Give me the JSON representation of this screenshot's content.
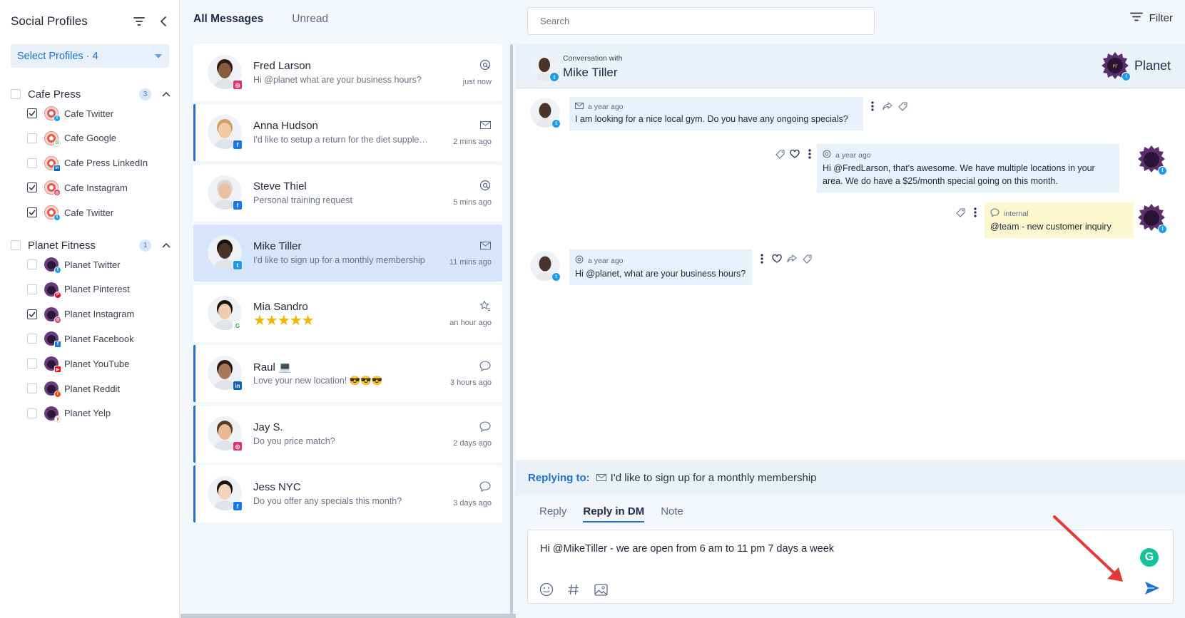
{
  "sidebar": {
    "title": "Social Profiles",
    "select_profiles": "Select Profiles · 4",
    "groups": [
      {
        "name": "Cafe Press",
        "count": "3",
        "profiles": [
          {
            "label": "Cafe Twitter",
            "checked": true,
            "network": "twitter"
          },
          {
            "label": "Cafe Google",
            "checked": false,
            "network": "google"
          },
          {
            "label": "Cafe Press LinkedIn",
            "checked": false,
            "network": "linkedin"
          },
          {
            "label": "Cafe Instagram",
            "checked": true,
            "network": "instagram"
          },
          {
            "label": "Cafe Twitter",
            "checked": true,
            "network": "twitter"
          }
        ]
      },
      {
        "name": "Planet Fitness",
        "count": "1",
        "profiles": [
          {
            "label": "Planet Twitter",
            "checked": false,
            "network": "twitter"
          },
          {
            "label": "Planet Pinterest",
            "checked": false,
            "network": "pinterest"
          },
          {
            "label": "Planet Instagram",
            "checked": true,
            "network": "instagram"
          },
          {
            "label": "Planet Facebook",
            "checked": false,
            "network": "facebook"
          },
          {
            "label": "Planet YouTube",
            "checked": false,
            "network": "youtube"
          },
          {
            "label": "Planet Reddit",
            "checked": false,
            "network": "reddit"
          },
          {
            "label": "Planet Yelp",
            "checked": false,
            "network": "yelp"
          }
        ]
      }
    ]
  },
  "inbox": {
    "tabs": [
      "All Messages",
      "Unread"
    ],
    "messages": [
      {
        "name": "Fred Larson",
        "preview": "Hi @planet what are your business hours?",
        "time": "just now",
        "type_icon": "at-icon",
        "network": "instagram"
      },
      {
        "name": "Anna Hudson",
        "preview": "I'd like to setup a return for the diet supplement I ordered",
        "time": "2 mins ago",
        "type_icon": "mail-icon",
        "network": "facebook"
      },
      {
        "name": "Steve Thiel",
        "preview": "Personal training request",
        "time": "5 mins ago",
        "type_icon": "at-icon",
        "network": "facebook"
      },
      {
        "name": "Mike Tiller",
        "preview": "I'd like to sign up for a monthly membership",
        "time": "11 mins ago",
        "type_icon": "mail-icon",
        "network": "twitter"
      },
      {
        "name": "Mia Sandro",
        "preview": "★★★★★",
        "time": "an hour ago",
        "type_icon": "star-review-icon",
        "network": "google",
        "rating": 5
      },
      {
        "name": "Raul 💻",
        "preview": "Love your new location! 😎😎😎",
        "time": "3 hours ago",
        "type_icon": "comment-icon",
        "network": "linkedin"
      },
      {
        "name": "Jay S.",
        "preview": "Do you price match?",
        "time": "2 days ago",
        "type_icon": "comment-icon",
        "network": "instagram"
      },
      {
        "name": "Jess NYC",
        "preview": "Do you offer any specials this month?",
        "time": "3 days ago",
        "type_icon": "comment-icon",
        "network": "facebook"
      }
    ]
  },
  "conversation": {
    "search_placeholder": "Search",
    "filter_label": "Filter",
    "with_label": "Conversation with",
    "contact": "Mike Tiller",
    "brand": "Planet",
    "messages": [
      {
        "direction": "in",
        "time": "a year ago",
        "text": "I am looking for a nice local gym. Do you have any ongoing specials?"
      },
      {
        "direction": "out",
        "time": "a year ago",
        "text_line1": "Hi @FredLarson, that's awesome. We have multiple locations in your",
        "text_line2": "area. We do have a $25/month special going on this month."
      },
      {
        "direction": "note",
        "time": "internal",
        "text": "@team - new customer inquiry"
      },
      {
        "direction": "in",
        "time": "a year ago",
        "text": "Hi @planet, what are your business hours?"
      }
    ],
    "replying_label": "Replying to:",
    "replying_to": "I'd like to sign up for a monthly membership",
    "reply_tabs": [
      "Reply",
      "Reply in DM",
      "Note"
    ],
    "active_reply_tab": "Reply in DM",
    "draft": "Hi @MikeTiller - we are open from 6 am to 11 pm 7 days a week",
    "grammarly": "G"
  },
  "colors": {
    "accent": "#1d6fd6",
    "selected_bg": "#d6e5fb",
    "panel_bg": "#f3f6fb",
    "note_bg": "#fdf8cf",
    "annotation_arrow": "#e53935"
  }
}
